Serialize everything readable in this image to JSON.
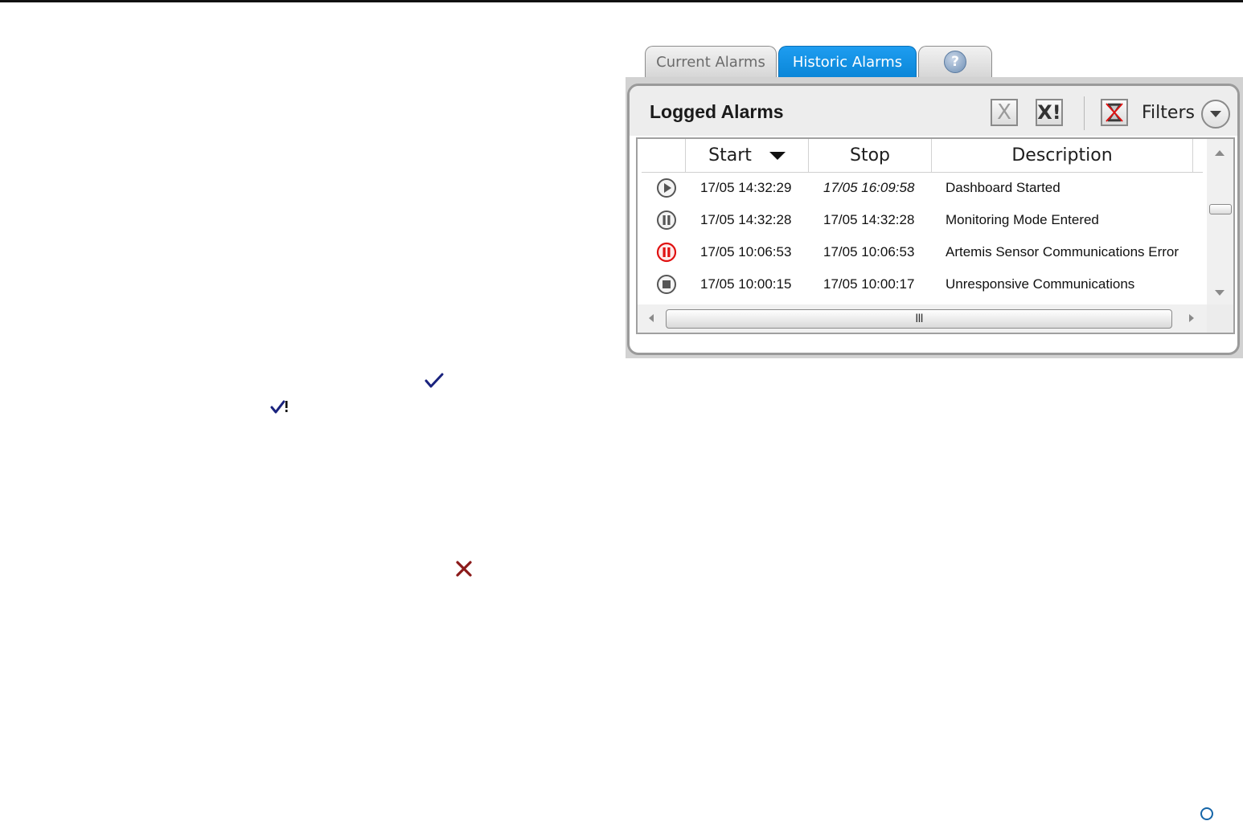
{
  "tabs": {
    "current_label": "Current Alarms",
    "historic_label": "Historic Alarms",
    "help_label": "?"
  },
  "panel": {
    "title": "Logged Alarms",
    "clear_icon": "X",
    "clear_all_icon": "X!",
    "filters_label": "Filters"
  },
  "table": {
    "columns": [
      "",
      "Start",
      "Stop",
      "Description"
    ],
    "sort_column": "Start",
    "sort_direction": "descending",
    "rows": [
      {
        "icon": "play-circle-icon",
        "start": "17/05 14:32:29",
        "stop": "17/05 16:09:58",
        "stop_italic": true,
        "description": "Dashboard Started"
      },
      {
        "icon": "pause-circle-icon",
        "start": "17/05 14:32:28",
        "stop": "17/05 14:32:28",
        "stop_italic": false,
        "description": "Monitoring Mode Entered"
      },
      {
        "icon": "pause-circle-red-icon",
        "start": "17/05 10:06:53",
        "stop": "17/05 10:06:53",
        "stop_italic": false,
        "description": "Artemis Sensor Communications Error"
      },
      {
        "icon": "stop-circle-icon",
        "start": "17/05 10:00:15",
        "stop": "17/05 10:00:17",
        "stop_italic": false,
        "description": "Unresponsive Communications"
      }
    ],
    "hscroll_grip": "III"
  },
  "colors": {
    "active_tab": "#0a86d8",
    "alert_red": "#e01010",
    "check_blue": "#1a237e",
    "cross_red": "#8b1a1a"
  }
}
